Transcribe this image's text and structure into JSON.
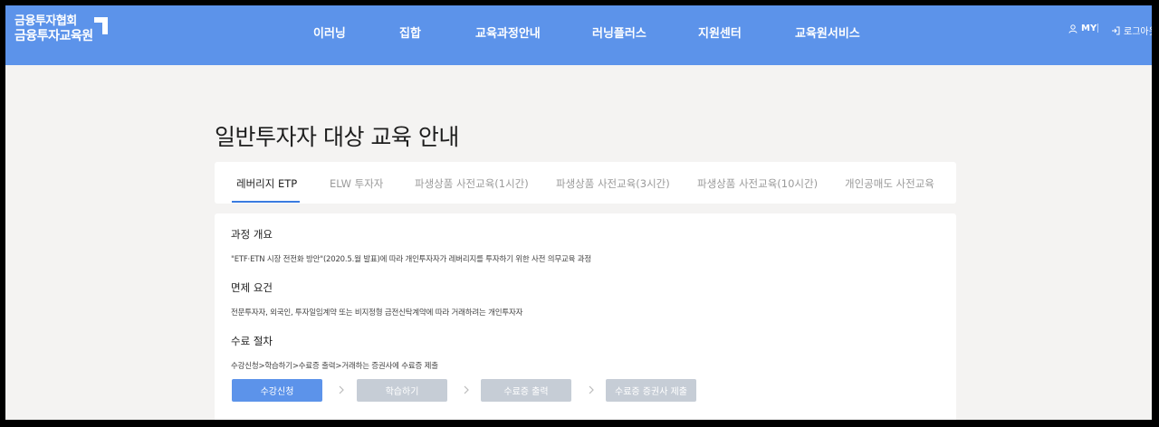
{
  "header": {
    "logo_line1": "금융투자협회",
    "logo_line2": "금융투자교육원",
    "nav": [
      "이러닝",
      "집합",
      "교육과정안내",
      "러닝플러스",
      "지원센터",
      "교육원서비스"
    ],
    "my_label": "MY",
    "login_label": "로그아웃",
    "brand_color": "#5c93ea"
  },
  "page": {
    "title": "일반투자자 대상 교육 안내"
  },
  "tabs": [
    {
      "label": "레버리지 ETP",
      "active": true
    },
    {
      "label": "ELW 투자자",
      "active": false
    },
    {
      "label": "파생상품 사전교육(1시간)",
      "active": false
    },
    {
      "label": "파생상품 사전교육(3시간)",
      "active": false
    },
    {
      "label": "파생상품 사전교육(10시간)",
      "active": false
    },
    {
      "label": "개인공매도 사전교육",
      "active": false
    }
  ],
  "sections": {
    "overview_title": "과정 개요",
    "overview_text": "\"ETF·ETN 시장 전전화 방안\"(2020.5.월 발표)에 따라 개인투자자가 레버리지를 투자하기 위한 사전 의무교육 과정",
    "exempt_title": "면제 요건",
    "exempt_text": "전문투자자, 외국인, 투자일임계약 또는 비지정형 금전신탁계약에 따라 거래하려는 개인투자자",
    "process_title": "수료 절차",
    "process_text": "수강신청>학습하기>수료증 출력>거래하는 증권사에 수료증 제출"
  },
  "steps": [
    {
      "label": "수강신청",
      "active": true
    },
    {
      "label": "학습하기",
      "active": false
    },
    {
      "label": "수료증 출력",
      "active": false
    },
    {
      "label": "수료증 증권사 제출",
      "active": false
    }
  ]
}
